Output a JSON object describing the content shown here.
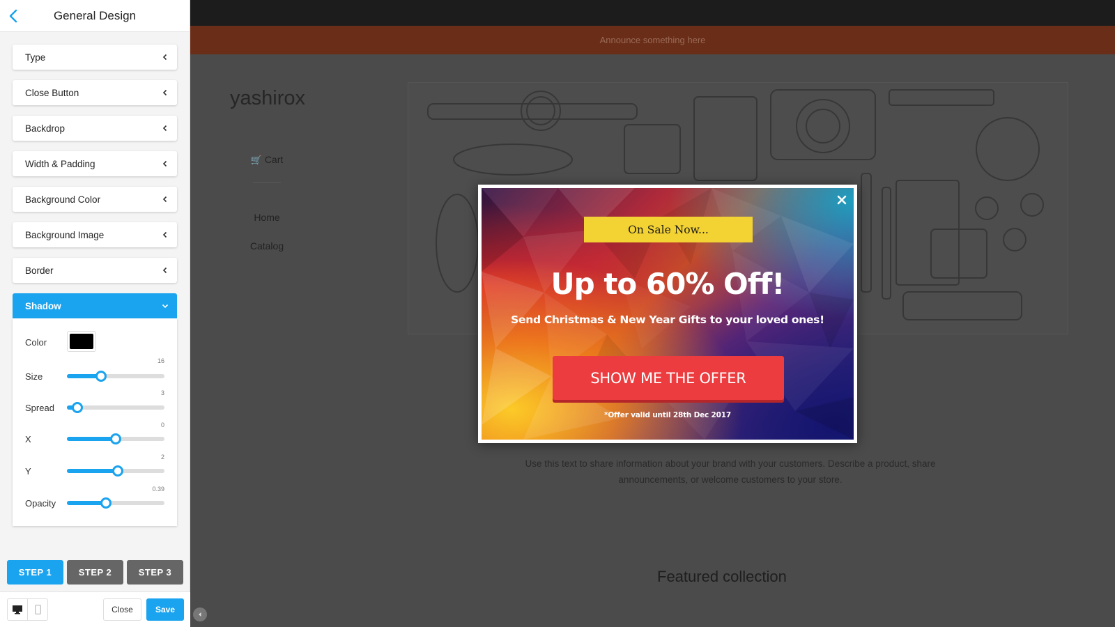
{
  "sidebar": {
    "title": "General Design",
    "sections": [
      {
        "label": "Type"
      },
      {
        "label": "Close Button"
      },
      {
        "label": "Backdrop"
      },
      {
        "label": "Width & Padding"
      },
      {
        "label": "Background Color"
      },
      {
        "label": "Background Image"
      },
      {
        "label": "Border"
      },
      {
        "label": "Shadow"
      }
    ],
    "shadow": {
      "color_label": "Color",
      "color_value": "#000000",
      "size": {
        "label": "Size",
        "value": "16",
        "fraction": 0.35
      },
      "spread": {
        "label": "Spread",
        "value": "3",
        "fraction": 0.11
      },
      "x": {
        "label": "X",
        "value": "0",
        "fraction": 0.5
      },
      "y": {
        "label": "Y",
        "value": "2",
        "fraction": 0.52
      },
      "opacity": {
        "label": "Opacity",
        "value": "0.39",
        "fraction": 0.4
      }
    },
    "steps": [
      "STEP 1",
      "STEP 2",
      "STEP 3"
    ],
    "close_label": "Close",
    "save_label": "Save"
  },
  "store": {
    "announcement": "Announce something here",
    "logo": "yashirox",
    "cart": "Cart",
    "nav": [
      "Home",
      "Catalog"
    ],
    "text": "Use this text to share information about your brand with your customers. Describe a product, share announcements, or welcome customers to your store.",
    "featured": "Featured collection"
  },
  "popup": {
    "tag": "On Sale Now...",
    "headline": "Up to 60% Off!",
    "subline": "Send Christmas & New Year Gifts to your loved ones!",
    "button": "SHOW ME THE OFFER",
    "validity": "*Offer valid until 28th Dec 2017"
  },
  "colors": {
    "accent": "#1aa3ee",
    "offer_button": "#ec3c3f",
    "sale_tag": "#f3d233"
  }
}
